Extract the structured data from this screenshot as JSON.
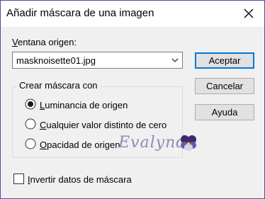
{
  "window": {
    "title": "Añadir máscara de una imagen"
  },
  "source": {
    "label_access_key": "V",
    "label_rest": "entana origen:",
    "selected_file": "masknoisette01.jpg"
  },
  "buttons": {
    "accept": "Aceptar",
    "cancel": "Cancelar",
    "help": "Ayuda"
  },
  "create_mask": {
    "legend": "Crear máscara con",
    "options": [
      {
        "access_key": "L",
        "rest": "uminancia de origen",
        "selected": true
      },
      {
        "access_key": "C",
        "rest": "ualquier valor distinto de cero",
        "selected": false
      },
      {
        "access_key": "O",
        "rest": "pacidad de origen",
        "selected": false
      }
    ]
  },
  "invert": {
    "access_key": "I",
    "rest": "nvertir datos de máscara",
    "checked": false
  },
  "watermark": {
    "text": "Evalynda"
  },
  "colors": {
    "window_border": "#4a4da8",
    "default_button_border": "#0078d7",
    "dialog_background": "#f0f0f0"
  },
  "icons": {
    "close": "close-icon",
    "dropdown": "chevron-down-icon",
    "watermark": "pansy-flower-icon"
  }
}
